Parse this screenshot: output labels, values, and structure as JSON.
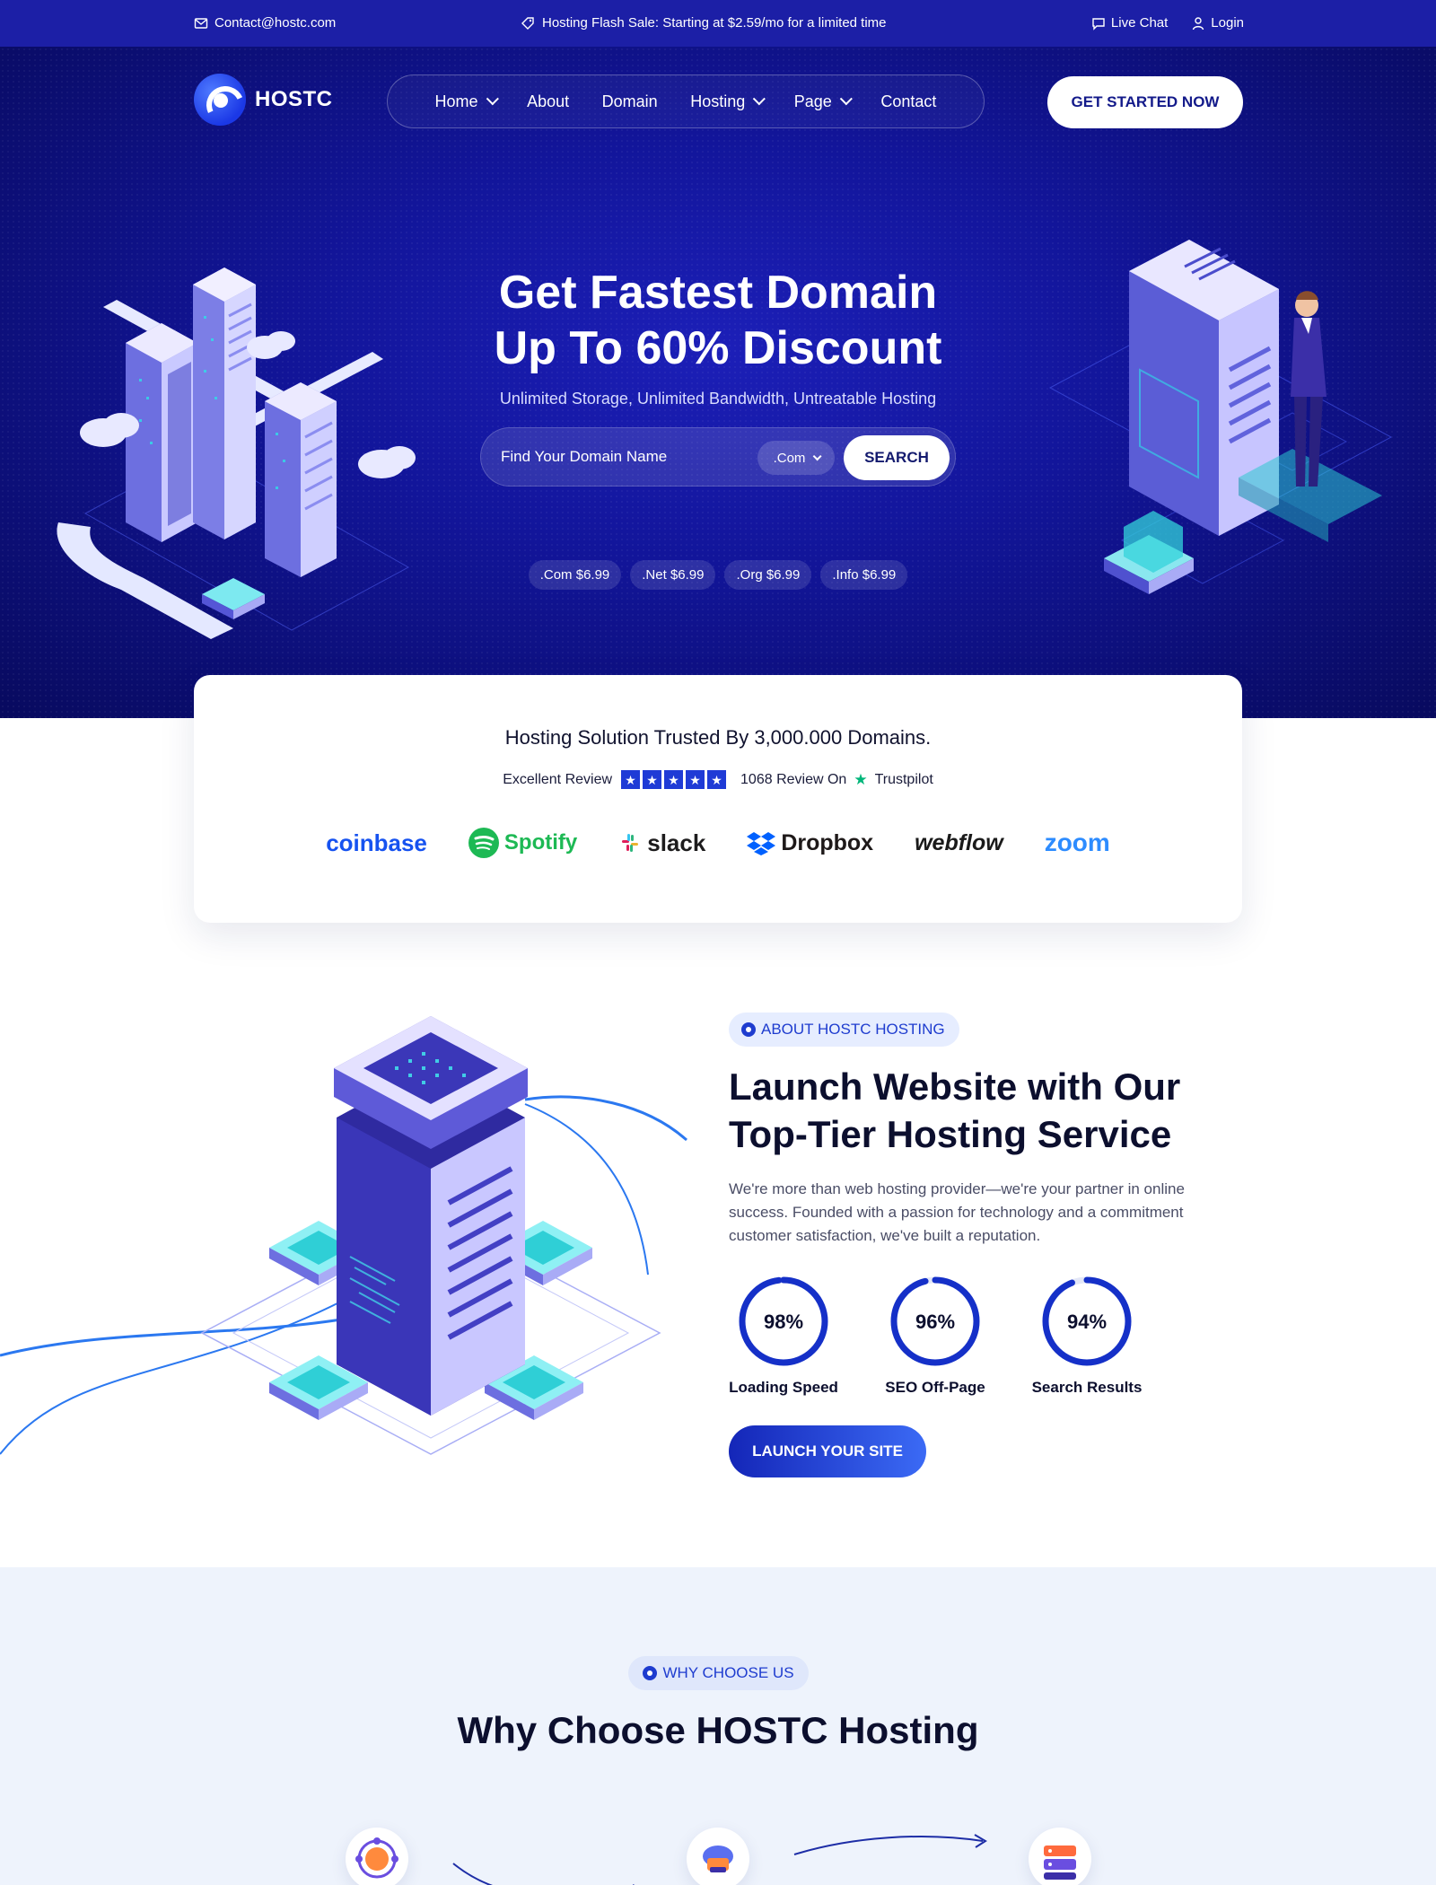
{
  "topbar": {
    "email": "Contact@hostc.com",
    "promo": "Hosting Flash Sale: Starting at $2.59/mo for a limited time",
    "live_chat": "Live Chat",
    "login": "Login"
  },
  "brand": {
    "name": "HOSTC"
  },
  "nav": {
    "items": [
      "Home",
      "About",
      "Domain",
      "Hosting",
      "Page",
      "Contact"
    ],
    "cta": "GET STARTED NOW"
  },
  "hero": {
    "title_line1": "Get Fastest Domain",
    "title_line2": "Up To 60% Discount",
    "subtitle": "Unlimited Storage, Unlimited Bandwidth, Untreatable Hosting",
    "search_placeholder": "Find Your Domain Name",
    "tld_selected": ".Com",
    "search_button": "SEARCH",
    "tld_prices": [
      ".Com $6.99",
      ".Net $6.99",
      ".Org $6.99",
      ".Info $6.99"
    ]
  },
  "trust": {
    "title": "Hosting Solution Trusted By 3,000.000 Domains.",
    "review_label": "Excellent Review",
    "rating_stars": 5,
    "review_count": "1068 Review On",
    "review_site": "Trustpilot",
    "brands": [
      "coinbase",
      "Spotify",
      "slack",
      "Dropbox",
      "webflow",
      "zoom"
    ]
  },
  "about": {
    "tag": "ABOUT HOSTC HOSTING",
    "title_line1": "Launch Website with Our",
    "title_line2": "Top-Tier Hosting Service",
    "text": "We're more than web hosting provider—we're your partner in online success. Founded with a passion for technology and a commitment customer satisfaction, we've built a reputation.",
    "stats": [
      {
        "value": "98%",
        "label": "Loading Speed",
        "percent": 98
      },
      {
        "value": "96%",
        "label": "SEO Off-Page",
        "percent": 96
      },
      {
        "value": "94%",
        "label": "Search Results",
        "percent": 94
      }
    ],
    "cta": "LAUNCH YOUR SITE"
  },
  "why": {
    "tag": "WHY CHOOSE US",
    "title": "Why Choose HOSTC Hosting"
  },
  "colors": {
    "primary": "#1c1fa6",
    "accent": "#1e3ccf",
    "hero_dark": "#080a5e",
    "trustpilot": "#00b67a"
  }
}
